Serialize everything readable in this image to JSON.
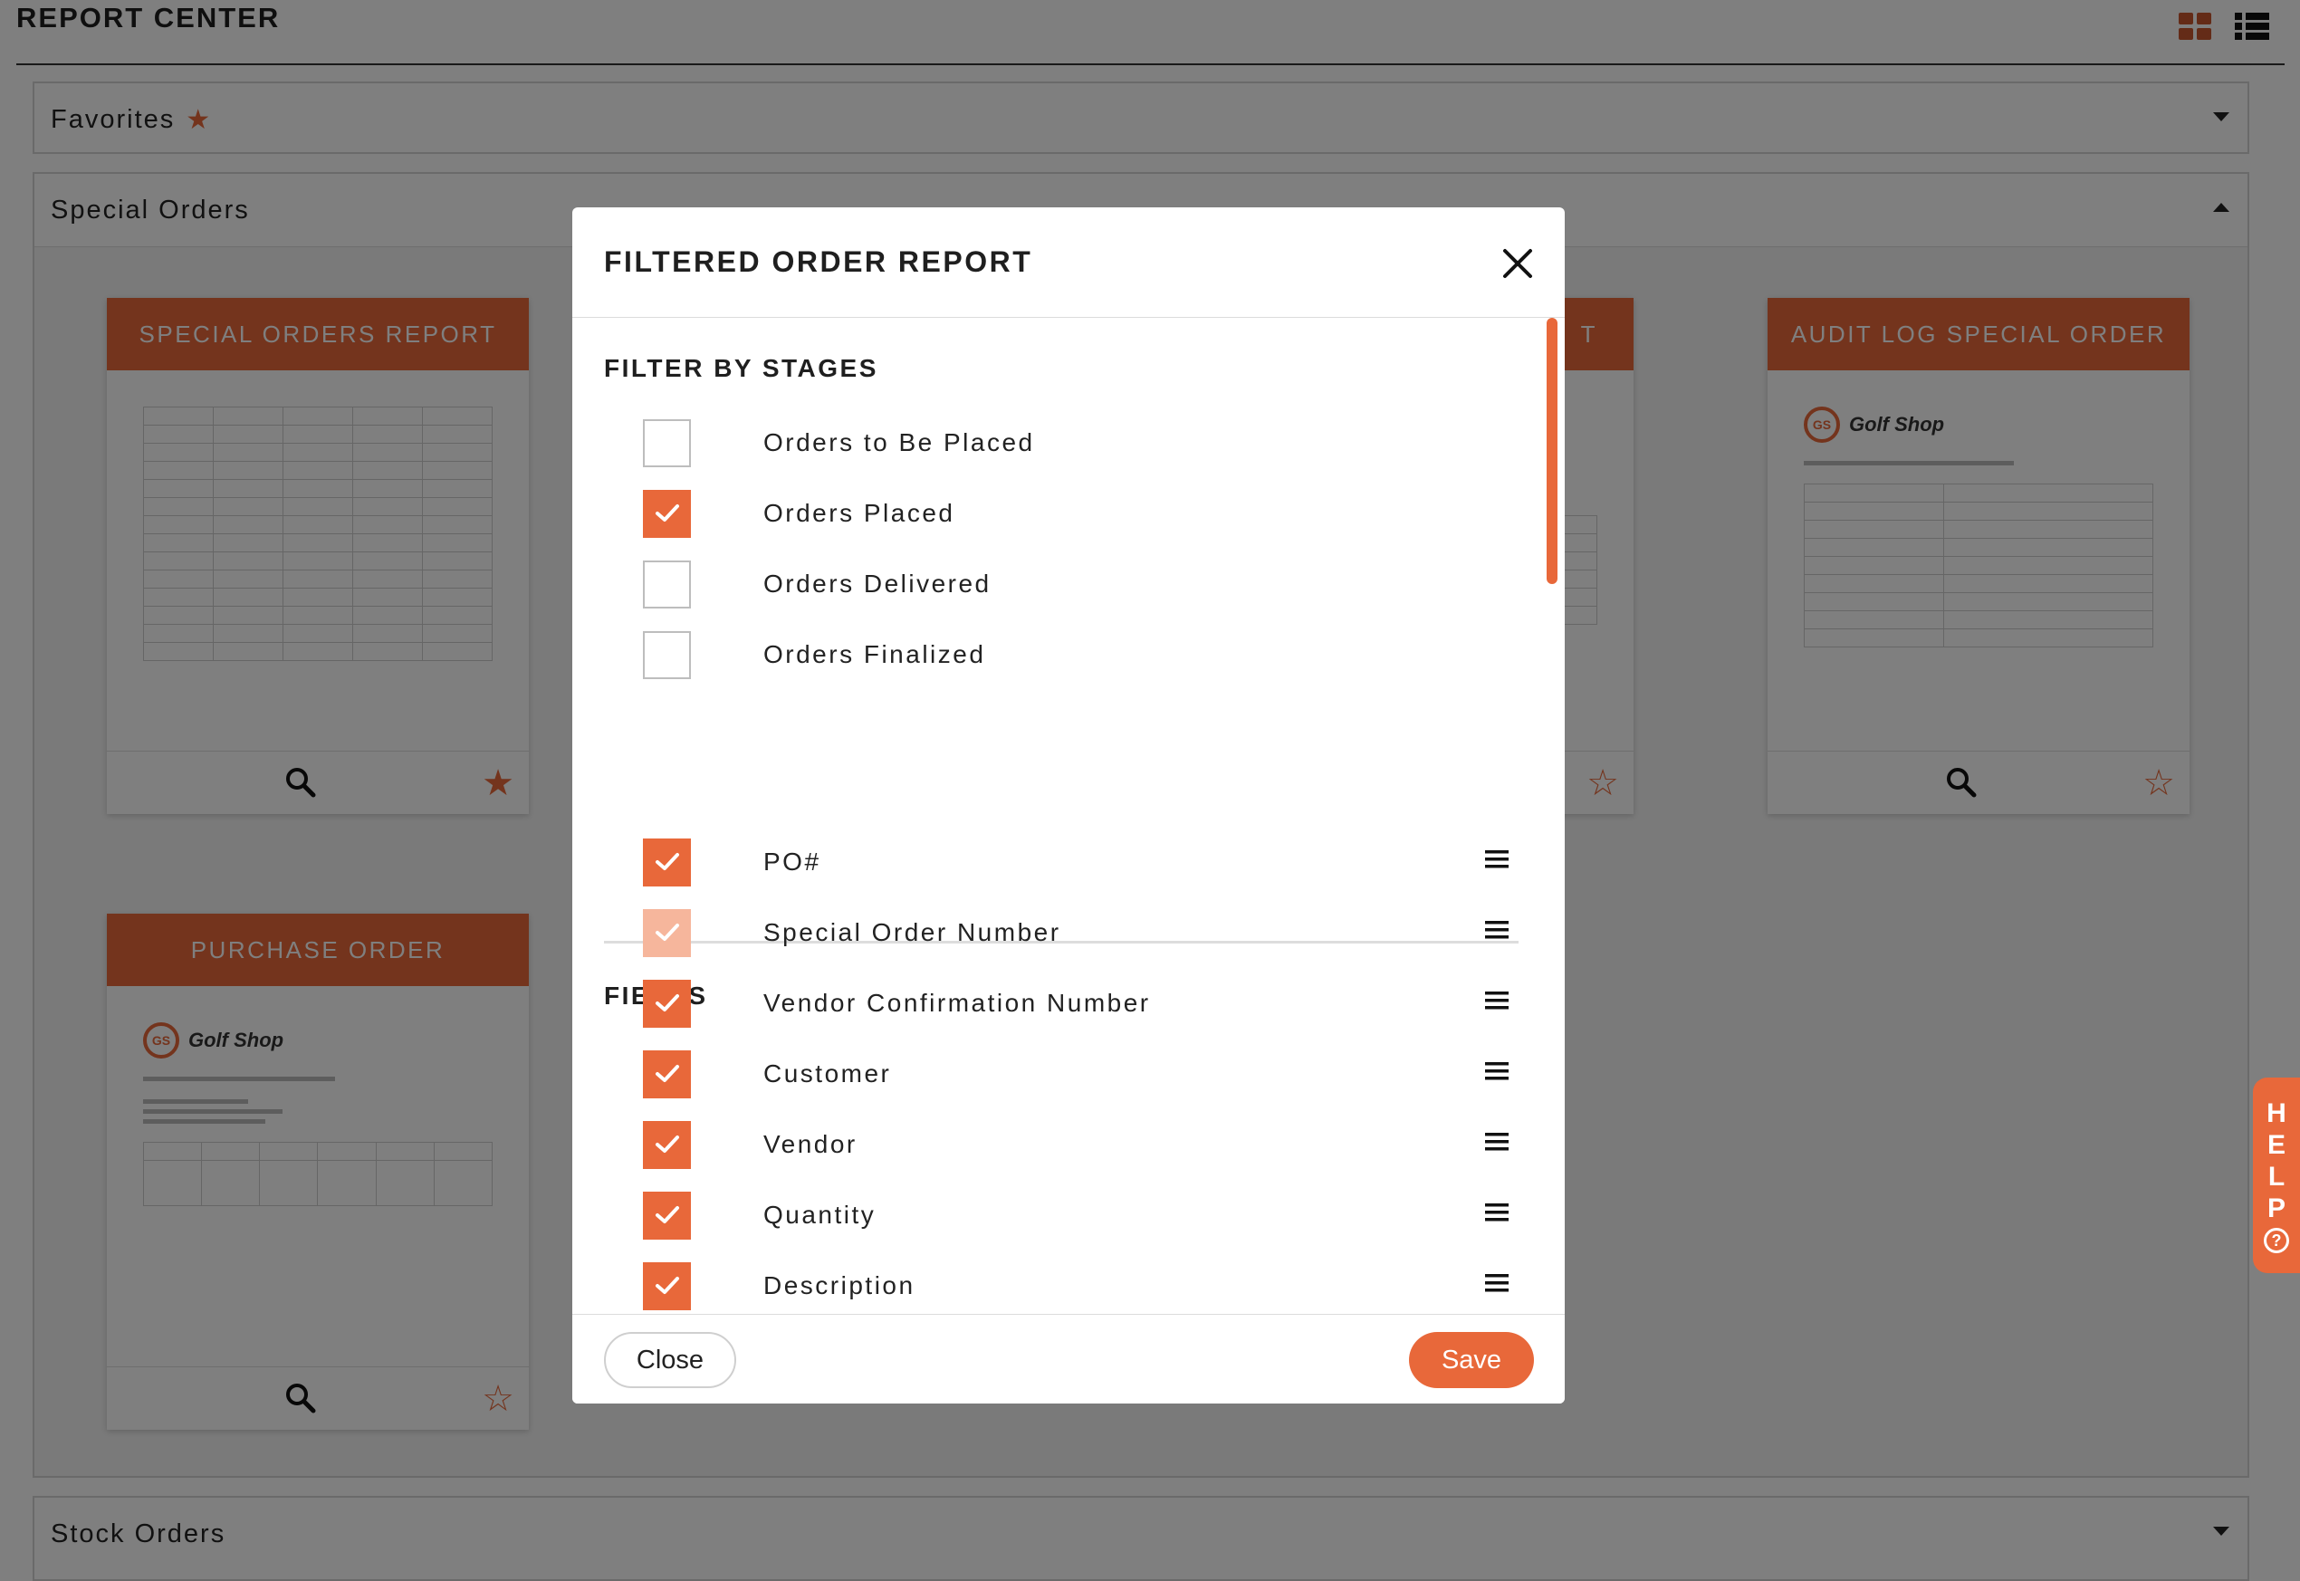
{
  "page": {
    "title": "REPORT CENTER"
  },
  "sections": {
    "favorites": {
      "label": "Favorites"
    },
    "special_orders": {
      "label": "Special Orders"
    },
    "stock_orders": {
      "label": "Stock Orders"
    }
  },
  "cards": [
    {
      "title": "SPECIAL ORDERS REPORT",
      "favorited": true
    },
    {
      "title": "T",
      "favorited": false
    },
    {
      "title": "AUDIT LOG SPECIAL ORDER",
      "favorited": false
    },
    {
      "title": "PURCHASE ORDER",
      "favorited": false
    }
  ],
  "card_preview": {
    "logo_badge": "GS",
    "logo_text": "Golf Shop"
  },
  "help": {
    "letters": [
      "H",
      "E",
      "L",
      "P"
    ],
    "icon": "?"
  },
  "modal": {
    "title": "FILTERED ORDER REPORT",
    "stages_heading": "FILTER BY STAGES",
    "stages": [
      {
        "label": "Orders to Be Placed",
        "checked": false
      },
      {
        "label": "Orders Placed",
        "checked": true
      },
      {
        "label": "Orders Delivered",
        "checked": false
      },
      {
        "label": "Orders Finalized",
        "checked": false
      }
    ],
    "fields_heading": "FIELDS",
    "fields": [
      {
        "label": "PO#",
        "checked": true,
        "disabled": false
      },
      {
        "label": "Special Order Number",
        "checked": true,
        "disabled": true
      },
      {
        "label": "Vendor Confirmation Number",
        "checked": true,
        "disabled": false
      },
      {
        "label": "Customer",
        "checked": true,
        "disabled": false
      },
      {
        "label": "Vendor",
        "checked": true,
        "disabled": false
      },
      {
        "label": "Quantity",
        "checked": true,
        "disabled": false
      },
      {
        "label": "Description",
        "checked": true,
        "disabled": false
      }
    ],
    "close_label": "Close",
    "save_label": "Save"
  },
  "colors": {
    "accent": "#e8683a",
    "accent_light": "#f6b69c"
  },
  "icons": {
    "close": "close-icon",
    "search": "search-icon",
    "star": "star-icon",
    "drag": "drag-handle-icon",
    "check": "check-icon"
  }
}
